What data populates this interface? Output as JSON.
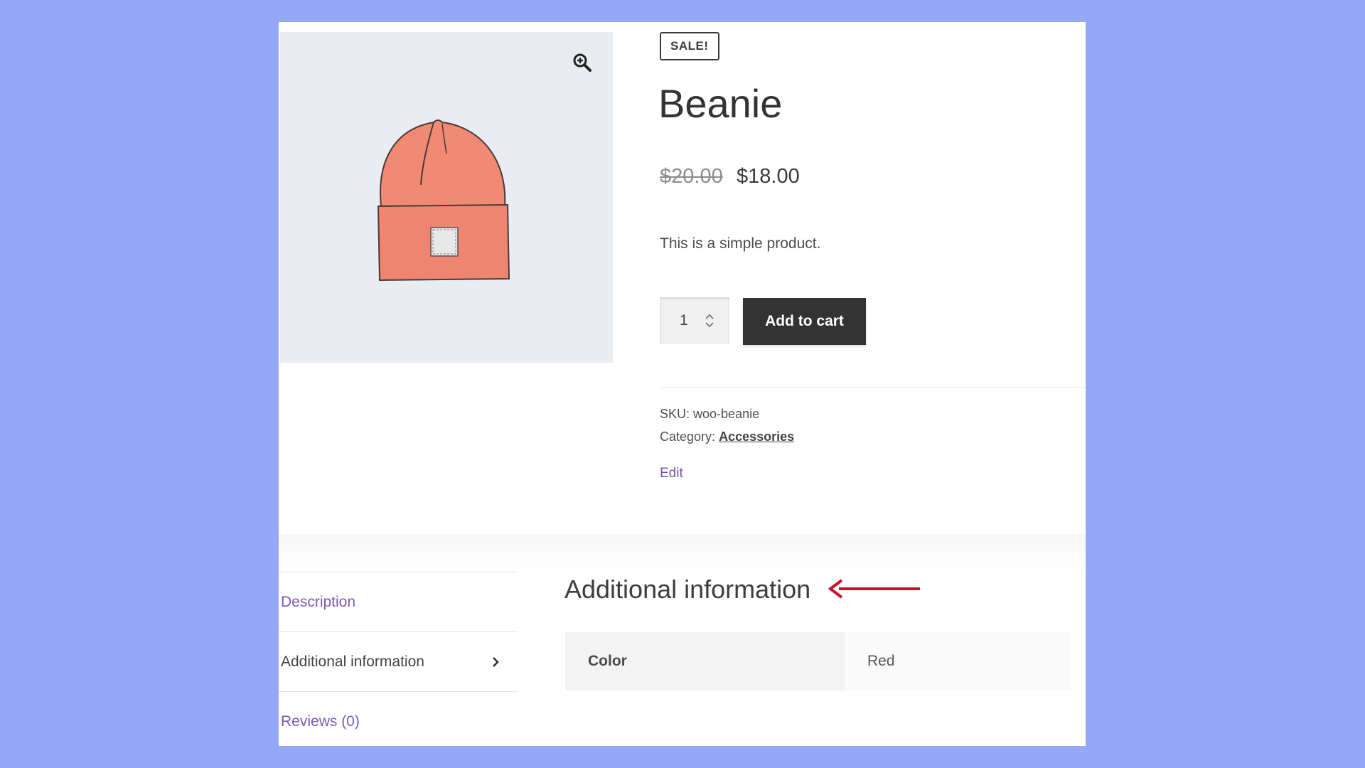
{
  "product": {
    "sale_badge": "SALE!",
    "title": "Beanie",
    "price_regular": "$20.00",
    "price_sale": "$18.00",
    "short_description": "This is a simple product.",
    "quantity": "1",
    "add_to_cart_label": "Add to cart",
    "sku_label": "SKU:",
    "sku_value": "woo-beanie",
    "category_label": "Category:",
    "category_value": "Accessories",
    "edit_label": "Edit",
    "image_icon": "zoom-in-icon"
  },
  "tabs": [
    {
      "label": "Description",
      "active": false
    },
    {
      "label": "Additional information",
      "active": true,
      "icon": "chevron-right-icon"
    },
    {
      "label": "Reviews (0)",
      "active": false
    }
  ],
  "additional_info": {
    "heading": "Additional information",
    "attributes": [
      {
        "name": "Color",
        "value": "Red"
      }
    ]
  },
  "colors": {
    "background": "#95a8f8",
    "button": "#333333",
    "link_purple": "#7b57b8",
    "annotation_arrow": "#c8102e",
    "beanie": "#f08a74"
  }
}
